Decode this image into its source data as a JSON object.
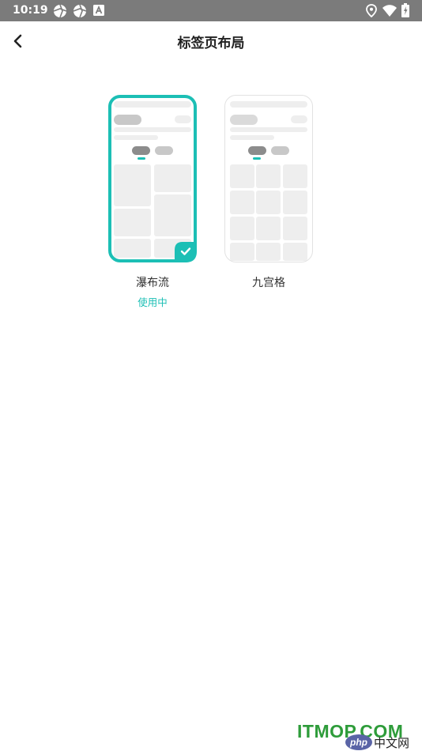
{
  "status_bar": {
    "time": "10:19",
    "left_icons": [
      "aperture-icon",
      "aperture-icon",
      "app-notification-icon"
    ],
    "right_icons": [
      "location-icon",
      "wifi-icon",
      "battery-charging-icon"
    ]
  },
  "header": {
    "title": "标签页布局",
    "back_icon": "chevron-left-icon"
  },
  "layouts": [
    {
      "label": "瀑布流",
      "status": "使用中",
      "selected": true
    },
    {
      "label": "九宫格",
      "status": "",
      "selected": false
    }
  ],
  "watermark": {
    "text": "ITMOP.COM",
    "badge_brand": "php",
    "badge_site": "中文网"
  },
  "colors": {
    "accent": "#1CBFB5",
    "status_bar_bg": "#7B7B7B",
    "title_text": "#222222",
    "placeholder_light": "#EEEEEE",
    "placeholder_dark": "#8C8C8C"
  }
}
